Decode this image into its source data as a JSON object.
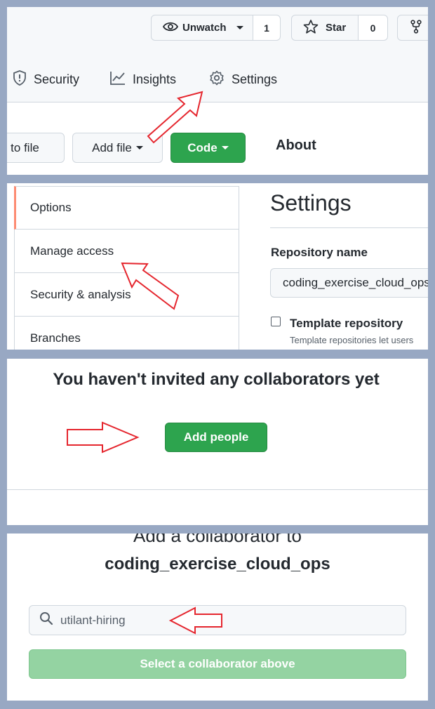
{
  "header": {
    "watch_label": "Unwatch",
    "watch_count": "1",
    "star_label": "Star",
    "star_count": "0"
  },
  "tabs": [
    {
      "label": "Security"
    },
    {
      "label": "Insights"
    },
    {
      "label": "Settings"
    }
  ],
  "toolbar": {
    "goto_file_label": "o to file",
    "add_file_label": "Add file",
    "code_label": "Code",
    "about_label": "About"
  },
  "settings": {
    "sidebar": [
      {
        "label": "Options"
      },
      {
        "label": "Manage access"
      },
      {
        "label": "Security & analysis"
      },
      {
        "label": "Branches"
      }
    ],
    "title": "Settings",
    "repo_name_label": "Repository name",
    "repo_name_value": "coding_exercise_cloud_ops",
    "template_label": "Template repository",
    "template_help": "Template repositories let users"
  },
  "collaborators": {
    "empty_heading": "You haven't invited any collaborators yet",
    "add_people_label": "Add people"
  },
  "add_dialog": {
    "title_line1": "Add a collaborator to",
    "title_line2": "coding_exercise_cloud_ops",
    "search_value": "utilant-hiring",
    "select_button_label": "Select a collaborator above"
  },
  "colors": {
    "background": "#98a8c3",
    "primary_green": "#2da44e",
    "disabled_green": "#94d3a2",
    "arrow_red": "#e5262e",
    "selected_accent": "#fd8c73"
  }
}
